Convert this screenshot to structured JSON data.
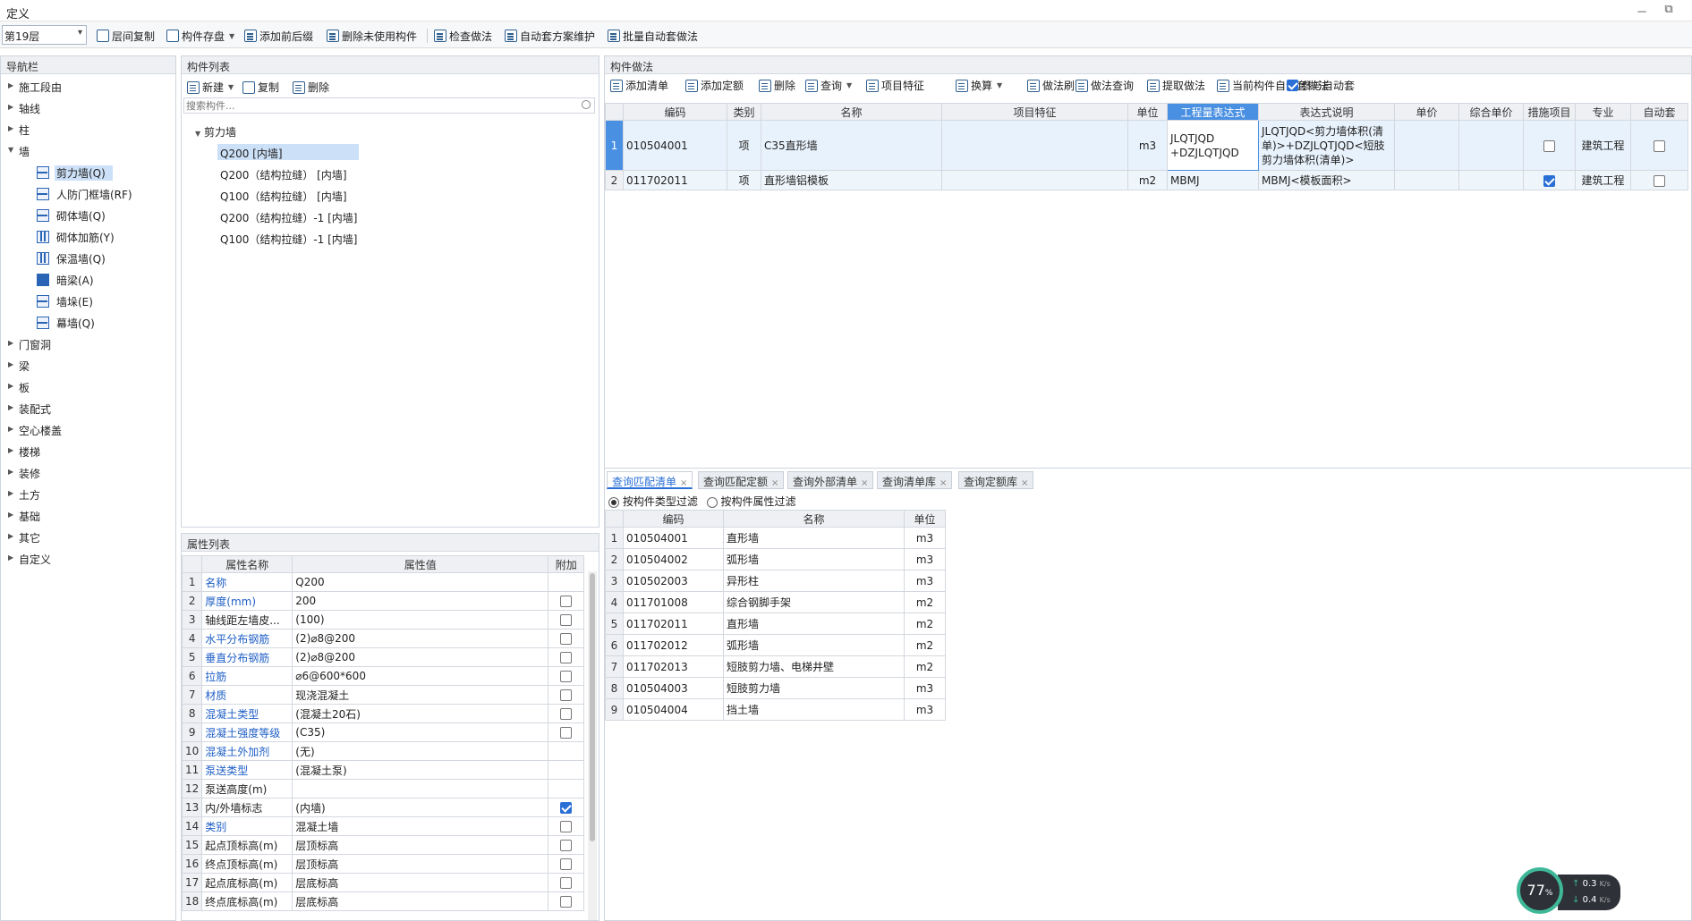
{
  "window": {
    "title": "定义",
    "min": "－",
    "restore": "⧉"
  },
  "toolbar": {
    "floor": "第19层",
    "buttons": [
      "层间复制",
      "构件存盘",
      "添加前后缀",
      "删除未使用构件",
      "检查做法",
      "自动套方案维护",
      "批量自动套做法"
    ]
  },
  "nav": {
    "title": "导航栏",
    "groups": [
      "施工段由",
      "轴线",
      "柱",
      "墙",
      "门窗洞",
      "梁",
      "板",
      "装配式",
      "空心楼盖",
      "楼梯",
      "装修",
      "土方",
      "基础",
      "其它",
      "自定义"
    ],
    "wall_children": [
      "剪力墙(Q)",
      "人防门框墙(RF)",
      "砌体墙(Q)",
      "砌体加筋(Y)",
      "保温墙(Q)",
      "暗梁(A)",
      "墙垛(E)",
      "幕墙(Q)"
    ]
  },
  "components": {
    "title": "构件列表",
    "buttons": [
      "新建",
      "复制",
      "删除"
    ],
    "search_placeholder": "搜索构件...",
    "root": "剪力墙",
    "items": [
      "Q200 [内墙]",
      "Q200（结构拉缝） [内墙]",
      "Q100（结构拉缝） [内墙]",
      "Q200（结构拉缝）-1 [内墙]",
      "Q100（结构拉缝）-1 [内墙]"
    ]
  },
  "properties": {
    "title": "属性列表",
    "headers": [
      "属性名称",
      "属性值",
      "附加"
    ],
    "rows": [
      {
        "n": "1",
        "name": "名称",
        "value": "Q200",
        "blue": true,
        "check": null
      },
      {
        "n": "2",
        "name": "厚度(mm)",
        "value": "200",
        "blue": true,
        "check": false
      },
      {
        "n": "3",
        "name": "轴线距左墙皮...",
        "value": "(100)",
        "blue": false,
        "check": false
      },
      {
        "n": "4",
        "name": "水平分布钢筋",
        "value": "(2)⌀8@200",
        "blue": true,
        "check": false
      },
      {
        "n": "5",
        "name": "垂直分布钢筋",
        "value": "(2)⌀8@200",
        "blue": true,
        "check": false
      },
      {
        "n": "6",
        "name": "拉筋",
        "value": "⌀6@600*600",
        "blue": true,
        "check": false
      },
      {
        "n": "7",
        "name": "材质",
        "value": "现浇混凝土",
        "blue": true,
        "check": false
      },
      {
        "n": "8",
        "name": "混凝土类型",
        "value": "(混凝土20石)",
        "blue": true,
        "check": false
      },
      {
        "n": "9",
        "name": "混凝土强度等级",
        "value": "(C35)",
        "blue": true,
        "check": false
      },
      {
        "n": "10",
        "name": "混凝土外加剂",
        "value": "(无)",
        "blue": true,
        "check": null
      },
      {
        "n": "11",
        "name": "泵送类型",
        "value": "(混凝土泵)",
        "blue": true,
        "check": null
      },
      {
        "n": "12",
        "name": "泵送高度(m)",
        "value": "",
        "blue": false,
        "check": null
      },
      {
        "n": "13",
        "name": "内/外墙标志",
        "value": "(内墙)",
        "blue": false,
        "check": true
      },
      {
        "n": "14",
        "name": "类别",
        "value": "混凝土墙",
        "blue": true,
        "check": false
      },
      {
        "n": "15",
        "name": "起点顶标高(m)",
        "value": "层顶标高",
        "blue": false,
        "check": false
      },
      {
        "n": "16",
        "name": "终点顶标高(m)",
        "value": "层顶标高",
        "blue": false,
        "check": false
      },
      {
        "n": "17",
        "name": "起点底标高(m)",
        "value": "层底标高",
        "blue": false,
        "check": false
      },
      {
        "n": "18",
        "name": "终点底标高(m)",
        "value": "层底标高",
        "blue": false,
        "check": false
      }
    ]
  },
  "method": {
    "title": "构件做法",
    "buttons": [
      "添加清单",
      "添加定额",
      "删除",
      "查询",
      "项目特征",
      "换算",
      "做法刷",
      "做法查询",
      "提取做法",
      "当前构件自动套做法",
      "参与自动套"
    ],
    "headers": [
      "编码",
      "类别",
      "名称",
      "项目特征",
      "单位",
      "工程量表达式",
      "表达式说明",
      "单价",
      "综合单价",
      "措施项目",
      "专业",
      "自动套"
    ],
    "rows": [
      {
        "n": "1",
        "code": "010504001",
        "type": "项",
        "name": "C35直形墙",
        "feature": "",
        "unit": "m3",
        "expr1": "JLQTJQD",
        "expr2": "+DZJLQTJQD",
        "desc1": "JLQTJQD<剪力墙体积(清",
        "desc2": "单)>+DZJLQTJQD<短肢",
        "desc3": "剪力墙体积(清单)>",
        "price": "",
        "cprice": "",
        "measure": false,
        "major": "建筑工程",
        "auto": false
      },
      {
        "n": "2",
        "code": "011702011",
        "type": "项",
        "name": "直形墙铝模板",
        "feature": "",
        "unit": "m2",
        "expr1": "MBMJ",
        "expr2": "",
        "desc1": "MBMJ<模板面积>",
        "desc2": "",
        "desc3": "",
        "price": "",
        "cprice": "",
        "measure": true,
        "major": "建筑工程",
        "auto": false
      }
    ]
  },
  "query": {
    "tabs": [
      "查询匹配清单",
      "查询匹配定额",
      "查询外部清单",
      "查询清单库",
      "查询定额库"
    ],
    "radio1": "按构件类型过滤",
    "radio2": "按构件属性过滤",
    "headers": [
      "编码",
      "名称",
      "单位"
    ],
    "rows": [
      {
        "n": "1",
        "code": "010504001",
        "name": "直形墙",
        "unit": "m3"
      },
      {
        "n": "2",
        "code": "010504002",
        "name": "弧形墙",
        "unit": "m3"
      },
      {
        "n": "3",
        "code": "010502003",
        "name": "异形柱",
        "unit": "m3"
      },
      {
        "n": "4",
        "code": "011701008",
        "name": "综合钢脚手架",
        "unit": "m2"
      },
      {
        "n": "5",
        "code": "011702011",
        "name": "直形墙",
        "unit": "m2"
      },
      {
        "n": "6",
        "code": "011702012",
        "name": "弧形墙",
        "unit": "m2"
      },
      {
        "n": "7",
        "code": "011702013",
        "name": "短肢剪力墙、电梯井壁",
        "unit": "m2"
      },
      {
        "n": "8",
        "code": "010504003",
        "name": "短肢剪力墙",
        "unit": "m3"
      },
      {
        "n": "9",
        "code": "010504004",
        "name": "挡土墙",
        "unit": "m3"
      }
    ]
  },
  "net": {
    "percent": "77",
    "pct_sign": "%",
    "up": "0.3",
    "down": "0.4",
    "unit": "K/s"
  }
}
